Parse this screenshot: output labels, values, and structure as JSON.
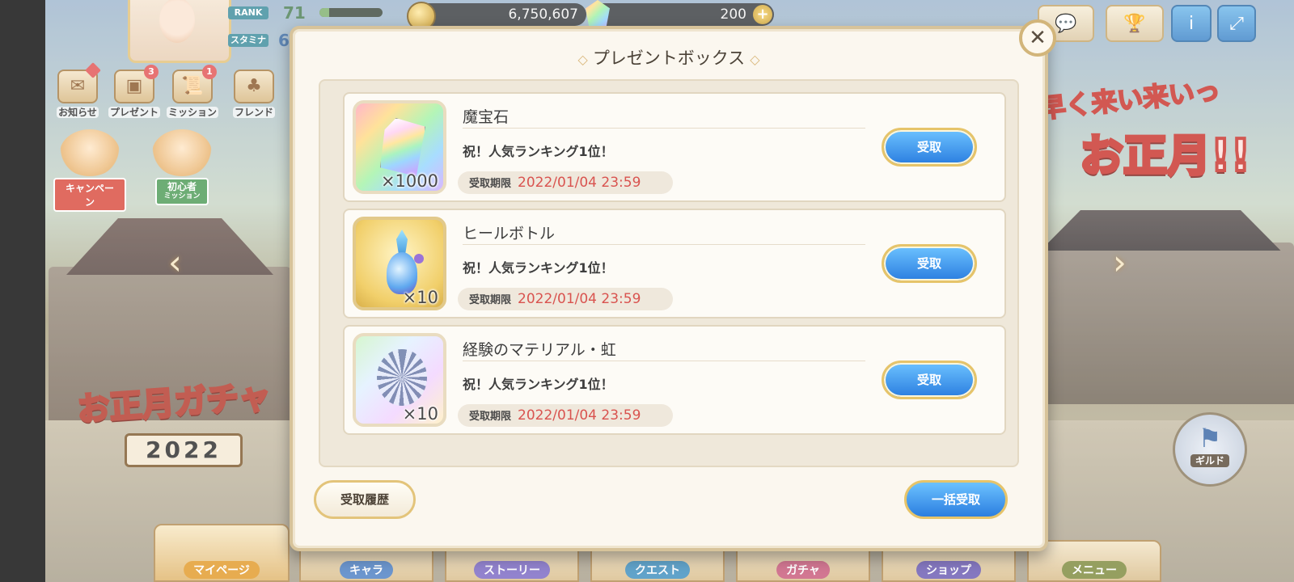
{
  "hud": {
    "rank_label": "RANK",
    "rank_value": "71",
    "rank_progress": 0.15,
    "stamina_label": "スタミナ",
    "stamina_value": "6",
    "gold": "6,750,607",
    "gems": "200",
    "plus_symbol": "+"
  },
  "top_buttons": [
    {
      "name": "chat",
      "icon": "chat-bubbles-icon",
      "glyph": "💬"
    },
    {
      "name": "ranking",
      "icon": "trophy-icon",
      "glyph": "🏆"
    },
    {
      "name": "info",
      "icon": "info-icon",
      "glyph": "ⅰ"
    },
    {
      "name": "fullscreen",
      "icon": "expand-icon",
      "glyph": "⤢"
    }
  ],
  "side_menu": {
    "notice": {
      "label": "お知らせ",
      "icon": "envelope-icon",
      "glyph": "✉"
    },
    "present": {
      "label": "プレゼント",
      "badge": "3",
      "icon": "treasure-chest-icon",
      "glyph": "▣"
    },
    "mission": {
      "label": "ミッション",
      "badge": "1",
      "icon": "scroll-icon",
      "glyph": "📜"
    },
    "friend": {
      "label": "フレンド",
      "icon": "clover-icon",
      "glyph": "♣"
    }
  },
  "promos": {
    "campaign": "キャンペーン",
    "beginner": "初心者",
    "beginner_sub": "ミッション"
  },
  "banners": {
    "gacha_title": "お正月ガチャ",
    "gacha_year": "2022",
    "event_line1": "早く来い来いっ",
    "event_line2": "お正月!!"
  },
  "guild": {
    "label": "ギルド",
    "icon": "flag-icon"
  },
  "bottom_nav": [
    "マイページ",
    "キャラ",
    "ストーリー",
    "クエスト",
    "ガチャ",
    "ショップ",
    "メニュー"
  ],
  "modal": {
    "title": "プレゼントボックス",
    "close_glyph": "✕",
    "deadline_label": "受取期限",
    "items": [
      {
        "name": "魔宝石",
        "description": "祝！人気ランキング1位！",
        "quantity": "×1000",
        "deadline": "2022/01/04 23:59",
        "receive_label": "受取",
        "icon": "rainbow-gem-icon"
      },
      {
        "name": "ヒールボトル",
        "description": "祝！人気ランキング1位！",
        "quantity": "×10",
        "deadline": "2022/01/04 23:59",
        "receive_label": "受取",
        "icon": "potion-bottle-icon"
      },
      {
        "name": "経験のマテリアル・虹",
        "description": "祝！人気ランキング1位！",
        "quantity": "×10",
        "deadline": "2022/01/04 23:59",
        "receive_label": "受取",
        "icon": "rainbow-material-icon"
      }
    ],
    "history_label": "受取履歴",
    "bulk_label": "一括受取"
  },
  "colors": {
    "receive_button": "#2b7ee0",
    "deadline_text": "#d9534f",
    "modal_border": "#d7c39a"
  }
}
